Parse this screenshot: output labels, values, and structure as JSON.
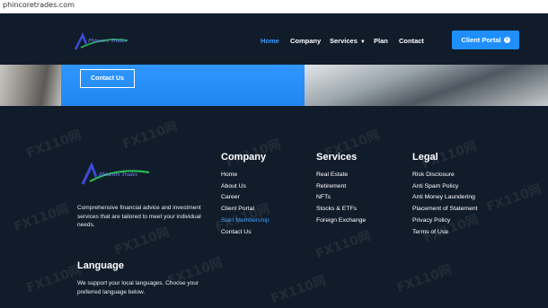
{
  "browser": {
    "url": "phincoretrades.com"
  },
  "brand": {
    "logo_text": "Phincore Trades"
  },
  "nav": {
    "items": [
      {
        "label": "Home",
        "active": true
      },
      {
        "label": "Company"
      },
      {
        "label": "Services",
        "has_dropdown": true
      },
      {
        "label": "Plan"
      },
      {
        "label": "Contact"
      }
    ],
    "portal_label": "Client Portal"
  },
  "hero": {
    "contact_label": "Contact Us"
  },
  "footer": {
    "description": "Comprehensive financial advice and investment services that are tailored to meet your individual needs.",
    "company": {
      "title": "Company",
      "links": [
        "Home",
        "About Us",
        "Career",
        "Client Portal",
        "Start Membership",
        "Contact Us"
      ]
    },
    "services": {
      "title": "Services",
      "links": [
        "Real Estate",
        "Retirement",
        "NFTs",
        "Stocks & ETFs",
        "Foreign Exchange"
      ]
    },
    "legal": {
      "title": "Legal",
      "links": [
        "Risk Disclosure",
        "Anti Spam Policy",
        "Anti Money Laundering",
        "Placement of Statement",
        "Privacy Policy",
        "Terms of Use"
      ]
    },
    "language": {
      "title": "Language",
      "text": "We support your local languages. Choose your preferred language below."
    }
  },
  "colors": {
    "accent": "#1f8fff",
    "background": "#111c2b",
    "highlight_link": "#3a9bff"
  },
  "watermark": "FX110网"
}
